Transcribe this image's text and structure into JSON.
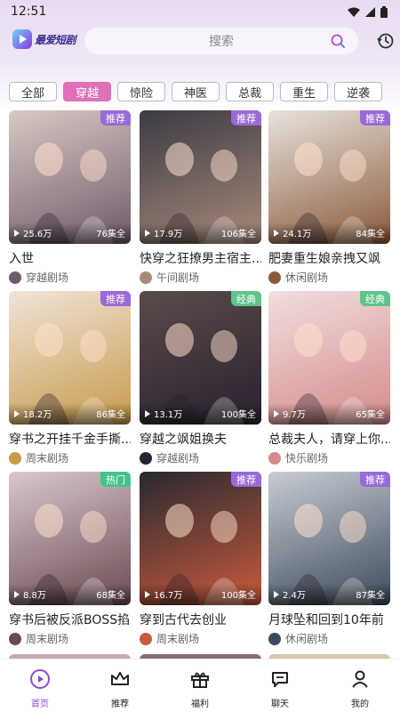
{
  "status": {
    "time": "12:51"
  },
  "header": {
    "logo_text": "最爱短剧",
    "search_placeholder": "搜索"
  },
  "tabs": [
    {
      "label": "全部",
      "active": false
    },
    {
      "label": "穿越",
      "active": true
    },
    {
      "label": "惊险",
      "active": false
    },
    {
      "label": "神医",
      "active": false
    },
    {
      "label": "总裁",
      "active": false
    },
    {
      "label": "重生",
      "active": false
    },
    {
      "label": "逆袭",
      "active": false
    }
  ],
  "cards": [
    {
      "title": "入世",
      "badge": "推荐",
      "plays": "25.6万",
      "episodes": "76集全",
      "source": "穿越剧场",
      "colors": [
        "#d8c9c4",
        "#6f5a6a"
      ]
    },
    {
      "title": "快穿之狂撩男主宿主...",
      "badge": "推荐",
      "plays": "17.9万",
      "episodes": "106集全",
      "source": "午间剧场",
      "colors": [
        "#3b3a44",
        "#a88a7a"
      ]
    },
    {
      "title": "肥妻重生娘亲拽又飒",
      "badge": "推荐",
      "plays": "24.1万",
      "episodes": "84集全",
      "source": "休闲剧场",
      "colors": [
        "#e8e2dc",
        "#8a5a3c"
      ]
    },
    {
      "title": "穿书之开挂千金手撕...",
      "badge": "推荐",
      "plays": "18.2万",
      "episodes": "86集全",
      "source": "周末剧场",
      "colors": [
        "#f0e4d8",
        "#c79a4c"
      ]
    },
    {
      "title": "穿越之飒姐换夫",
      "badge": "经典",
      "plays": "13.1万",
      "episodes": "100集全",
      "source": "穿越剧场",
      "colors": [
        "#5a4a4a",
        "#2a2230"
      ]
    },
    {
      "title": "总裁夫人，请穿上你...",
      "badge": "经典",
      "plays": "9.7万",
      "episodes": "65集全",
      "source": "快乐剧场",
      "colors": [
        "#f2dede",
        "#d48a8a"
      ]
    },
    {
      "title": "穿书后被反派BOSS掐...",
      "badge": "热门",
      "plays": "8.8万",
      "episodes": "68集全",
      "source": "周末剧场",
      "colors": [
        "#d8c8cc",
        "#6a4a52"
      ]
    },
    {
      "title": "穿到古代去创业",
      "badge": "推荐",
      "plays": "16.7万",
      "episodes": "100集全",
      "source": "周末剧场",
      "colors": [
        "#2a2a30",
        "#c85a3c"
      ]
    },
    {
      "title": "月球坠和回到10年前",
      "badge": "推荐",
      "plays": "2.4万",
      "episodes": "87集全",
      "source": "休闲剧场",
      "colors": [
        "#c8ccd4",
        "#3c4a5a"
      ]
    }
  ],
  "nav": [
    {
      "label": "首页",
      "icon": "home-play-icon",
      "active": true
    },
    {
      "label": "推荐",
      "icon": "crown-icon",
      "active": false
    },
    {
      "label": "福利",
      "icon": "gift-icon",
      "active": false
    },
    {
      "label": "聊天",
      "icon": "chat-icon",
      "active": false
    },
    {
      "label": "我的",
      "icon": "profile-icon",
      "active": false
    }
  ],
  "colors": {
    "accent": "#8a4ad0",
    "tab_active": "#e070b8",
    "badge_recommend": "#9a6ad8",
    "badge_classic": "#5fc48a",
    "badge_hot": "#45c28a"
  }
}
